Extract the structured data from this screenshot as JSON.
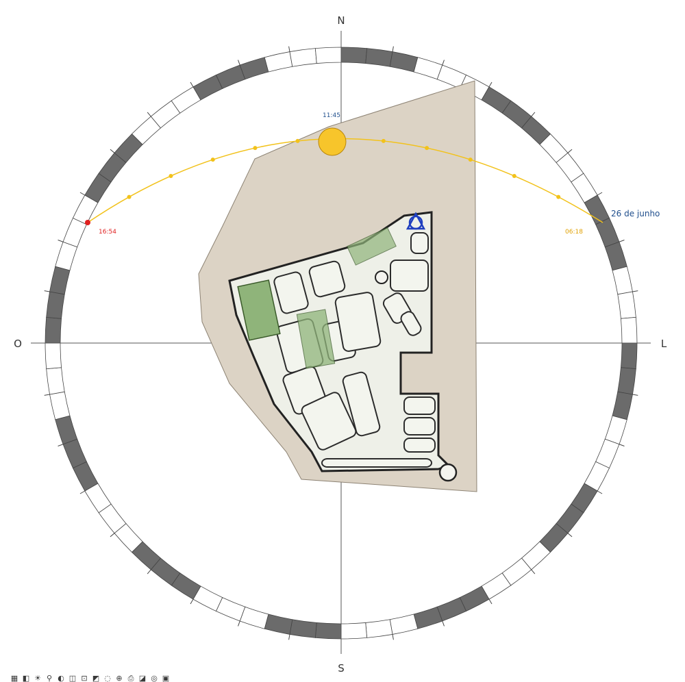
{
  "compass": {
    "north": "N",
    "south": "S",
    "east": "L",
    "west": "O",
    "ring_segments": 72,
    "ring_dark_color": "#6b6b6b",
    "ring_light_color": "#ffffff"
  },
  "sun_path": {
    "date_label": "26 de junho",
    "date_color": "#1f4e8c",
    "noon_time": "11:45",
    "noon_color": "#1f4e8c",
    "sunrise_time": "06:18",
    "sunrise_color": "#e0a000",
    "sunset_time": "16:54",
    "sunset_color": "#e02020",
    "path_color": "#f2c21b",
    "sun_color": "#f7c52b"
  },
  "site": {
    "terrain_color": "#dcd3c5",
    "block_color": "#eef0e8",
    "road_color": "#2b2b2b",
    "green_color": "#8fb47a",
    "marker_icon": "triangle-circle-marker-icon",
    "marker_color": "#1f3fbf"
  },
  "toolbar": {
    "icons": [
      "grid-icon",
      "cube-icon",
      "sun-icon",
      "search-icon",
      "shadow-icon",
      "camera-icon",
      "crop-icon",
      "render-icon",
      "hide-icon",
      "zoom-icon",
      "print-icon",
      "section-icon",
      "layers-icon",
      "view-icon"
    ],
    "glyphs": [
      "▦",
      "◧",
      "☀",
      "⚲",
      "◐",
      "◫",
      "⊡",
      "◩",
      "◌",
      "⊕",
      "⎙",
      "◪",
      "◎",
      "▣"
    ]
  }
}
